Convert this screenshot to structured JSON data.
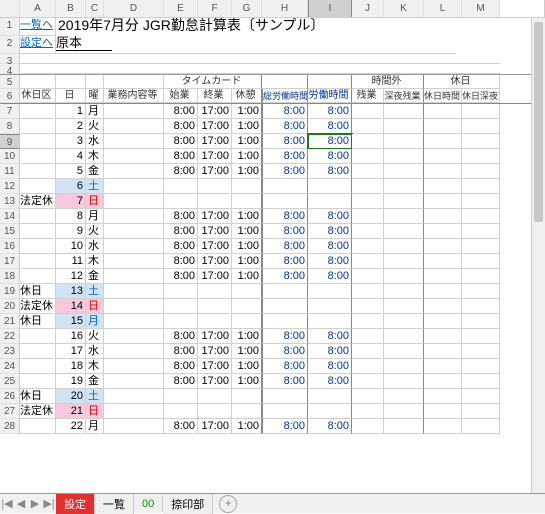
{
  "cols": [
    "",
    "A",
    "B",
    "C",
    "D",
    "E",
    "F",
    "G",
    "H",
    "I",
    "J",
    "K",
    "L",
    "M"
  ],
  "selected_col_index": 9,
  "selected_row": 9,
  "link1": "一覧へ",
  "link2": "設定へ",
  "title": "2019年7月分 JGR勤怠計算表〔サンプル〕",
  "subtitle": "原本",
  "group_time": "タイムカード",
  "group_ot": "時間外",
  "group_hol": "休日",
  "h_holku": "休日区",
  "h_hi": "日",
  "h_you": "曜",
  "h_gyomu": "業務内容等",
  "h_start": "始業",
  "h_end": "終業",
  "h_break": "休憩",
  "h_total": "総労働時間",
  "h_work": "労働時間",
  "h_zan": "残業",
  "h_late": "深夜残業",
  "h_holtime": "休日時間",
  "h_hollate": "休日深夜",
  "rows": [
    {
      "r": 7,
      "d": "1",
      "y": "月",
      "s": "8:00",
      "e": "17:00",
      "b": "1:00",
      "t": "8:00",
      "w": "8:00"
    },
    {
      "r": 8,
      "d": "2",
      "y": "火",
      "s": "8:00",
      "e": "17:00",
      "b": "1:00",
      "t": "8:00",
      "w": "8:00"
    },
    {
      "r": 9,
      "d": "3",
      "y": "水",
      "s": "8:00",
      "e": "17:00",
      "b": "1:00",
      "t": "8:00",
      "w": "8:00"
    },
    {
      "r": 10,
      "d": "4",
      "y": "木",
      "s": "8:00",
      "e": "17:00",
      "b": "1:00",
      "t": "8:00",
      "w": "8:00"
    },
    {
      "r": 11,
      "d": "5",
      "y": "金",
      "s": "8:00",
      "e": "17:00",
      "b": "1:00",
      "t": "8:00",
      "w": "8:00"
    },
    {
      "r": 12,
      "d": "6",
      "y": "土",
      "cls": "blueday"
    },
    {
      "r": 13,
      "hk": "法定休",
      "d": "7",
      "y": "日",
      "cls": "redday"
    },
    {
      "r": 14,
      "d": "8",
      "y": "月",
      "s": "8:00",
      "e": "17:00",
      "b": "1:00",
      "t": "8:00",
      "w": "8:00"
    },
    {
      "r": 15,
      "d": "9",
      "y": "火",
      "s": "8:00",
      "e": "17:00",
      "b": "1:00",
      "t": "8:00",
      "w": "8:00"
    },
    {
      "r": 16,
      "d": "10",
      "y": "水",
      "s": "8:00",
      "e": "17:00",
      "b": "1:00",
      "t": "8:00",
      "w": "8:00"
    },
    {
      "r": 17,
      "d": "11",
      "y": "木",
      "s": "8:00",
      "e": "17:00",
      "b": "1:00",
      "t": "8:00",
      "w": "8:00"
    },
    {
      "r": 18,
      "d": "12",
      "y": "金",
      "s": "8:00",
      "e": "17:00",
      "b": "1:00",
      "t": "8:00",
      "w": "8:00"
    },
    {
      "r": 19,
      "hk": "休日",
      "d": "13",
      "y": "土",
      "cls": "blueday"
    },
    {
      "r": 20,
      "hk": "法定休",
      "d": "14",
      "y": "日",
      "cls": "redday"
    },
    {
      "r": 21,
      "hk": "休日",
      "d": "15",
      "y": "月",
      "cls": "blueday"
    },
    {
      "r": 22,
      "d": "16",
      "y": "火",
      "s": "8:00",
      "e": "17:00",
      "b": "1:00",
      "t": "8:00",
      "w": "8:00"
    },
    {
      "r": 23,
      "d": "17",
      "y": "水",
      "s": "8:00",
      "e": "17:00",
      "b": "1:00",
      "t": "8:00",
      "w": "8:00"
    },
    {
      "r": 24,
      "d": "18",
      "y": "木",
      "s": "8:00",
      "e": "17:00",
      "b": "1:00",
      "t": "8:00",
      "w": "8:00"
    },
    {
      "r": 25,
      "d": "19",
      "y": "金",
      "s": "8:00",
      "e": "17:00",
      "b": "1:00",
      "t": "8:00",
      "w": "8:00"
    },
    {
      "r": 26,
      "hk": "休日",
      "d": "20",
      "y": "土",
      "cls": "blueday"
    },
    {
      "r": 27,
      "hk": "法定休",
      "d": "21",
      "y": "日",
      "cls": "redday"
    },
    {
      "r": 28,
      "d": "22",
      "y": "月",
      "s": "8:00",
      "e": "17:00",
      "b": "1:00",
      "t": "8:00",
      "w": "8:00"
    }
  ],
  "tabs": {
    "nav": [
      "|◀",
      "◀",
      "▶",
      "▶|"
    ],
    "t1": "設定",
    "t2": "一覧",
    "t3": "00",
    "t4": "捺印部"
  }
}
